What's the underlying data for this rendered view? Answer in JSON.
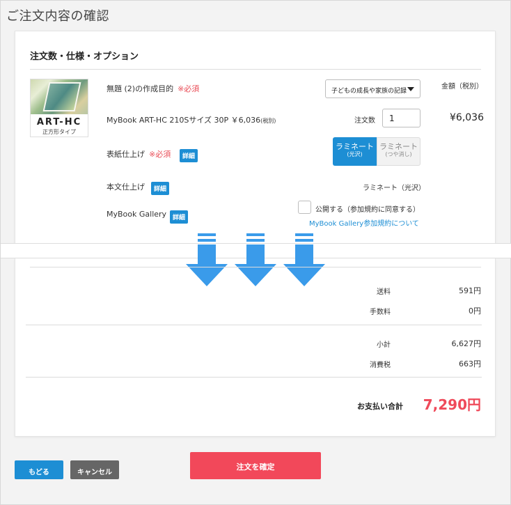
{
  "page": {
    "title": "ご注文内容の確認"
  },
  "options": {
    "section_title": "注文数・仕様・オプション",
    "product": {
      "code": "ART-HC",
      "type": "正方形タイプ"
    },
    "title_purpose": {
      "label": "無題 (2)の作成目的",
      "required": "※必須",
      "selected": "子どもの成長や家族の記録"
    },
    "price_header": "金額（税別）",
    "item": {
      "label": "MyBook ART-HC 210Sサイズ 30P ￥6,036",
      "tax_note": "(税別)",
      "qty_label": "注文数",
      "qty_value": "1",
      "amount": "¥6,036"
    },
    "cover_finish": {
      "label": "表紙仕上げ",
      "required": "※必須",
      "detail": "詳細",
      "option_active": {
        "name": "ラミネート",
        "sub": "(光沢)"
      },
      "option_inactive": {
        "name": "ラミネート",
        "sub": "(つや消し)"
      }
    },
    "body_finish": {
      "label": "本文仕上げ",
      "detail": "詳細",
      "value": "ラミネート（光沢）"
    },
    "gallery": {
      "label": "MyBook Gallery",
      "detail": "詳細",
      "checkbox_label": "公開する（参加規約に同意する）",
      "link": "MyBook Gallery参加規約について"
    }
  },
  "summary": {
    "rows": [
      {
        "label": "送料",
        "value": "591円"
      },
      {
        "label": "手数料",
        "value": "0円"
      },
      {
        "label": "小計",
        "value": "6,627円"
      },
      {
        "label": "消費税",
        "value": "663円"
      }
    ],
    "total_label": "お支払い合計",
    "total_value": "7,290円"
  },
  "buttons": {
    "back": "もどる",
    "cancel": "キャンセル",
    "confirm": "注文を確定"
  },
  "colors": {
    "accent": "#1d8ed4",
    "required": "#e94b55",
    "total": "#ef4a5a",
    "arrow": "#3a9bea"
  }
}
